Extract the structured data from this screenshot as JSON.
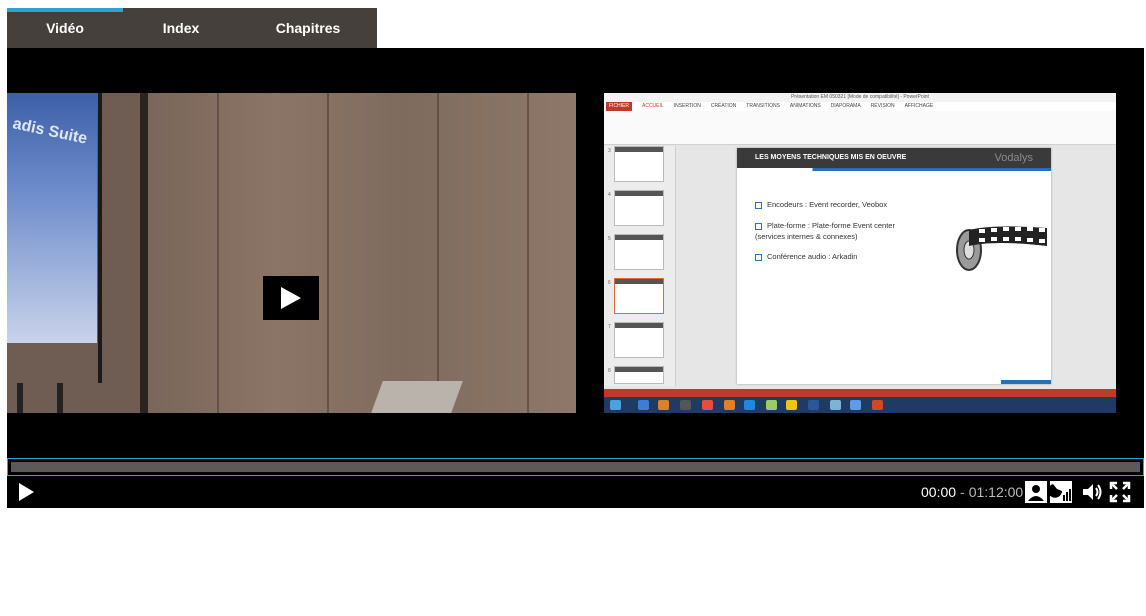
{
  "tabs": [
    {
      "label": "Vidéo",
      "active": true
    },
    {
      "label": "Index",
      "active": false
    },
    {
      "label": "Chapitres",
      "active": false
    }
  ],
  "player": {
    "current_time": "00:00",
    "separator": "-",
    "duration": "01:12:00",
    "progress_fraction": 0,
    "accent_color": "#2ea3d6"
  },
  "camera_video": {
    "brand_text": "adis Suite"
  },
  "slide": {
    "window_title": "Présentation EM 050321 [Mode de compatibilité] - PowerPoint",
    "menu": [
      "FICHIER",
      "ACCUEIL",
      "INSERTION",
      "CRÉATION",
      "TRANSITIONS",
      "ANIMATIONS",
      "DIAPORAMA",
      "RÉVISION",
      "AFFICHAGE"
    ],
    "heading": "LES MOYENS TECHNIQUES MIS EN OEUVRE",
    "logo": "Vodalys",
    "bullets": [
      "Encodeurs : Event recorder, Veobox",
      "Plate-forme : Plate-forme Event center",
      "(services internes & connexes)",
      "Conférence audio : Arkadin"
    ],
    "thumb_numbers": [
      "3",
      "4",
      "5",
      "6",
      "7",
      "8"
    ]
  },
  "icons": {
    "play": "play-icon",
    "camera_view": "person-view-icon",
    "slides_view": "slides-view-icon",
    "volume": "volume-icon",
    "fullscreen": "fullscreen-icon"
  }
}
